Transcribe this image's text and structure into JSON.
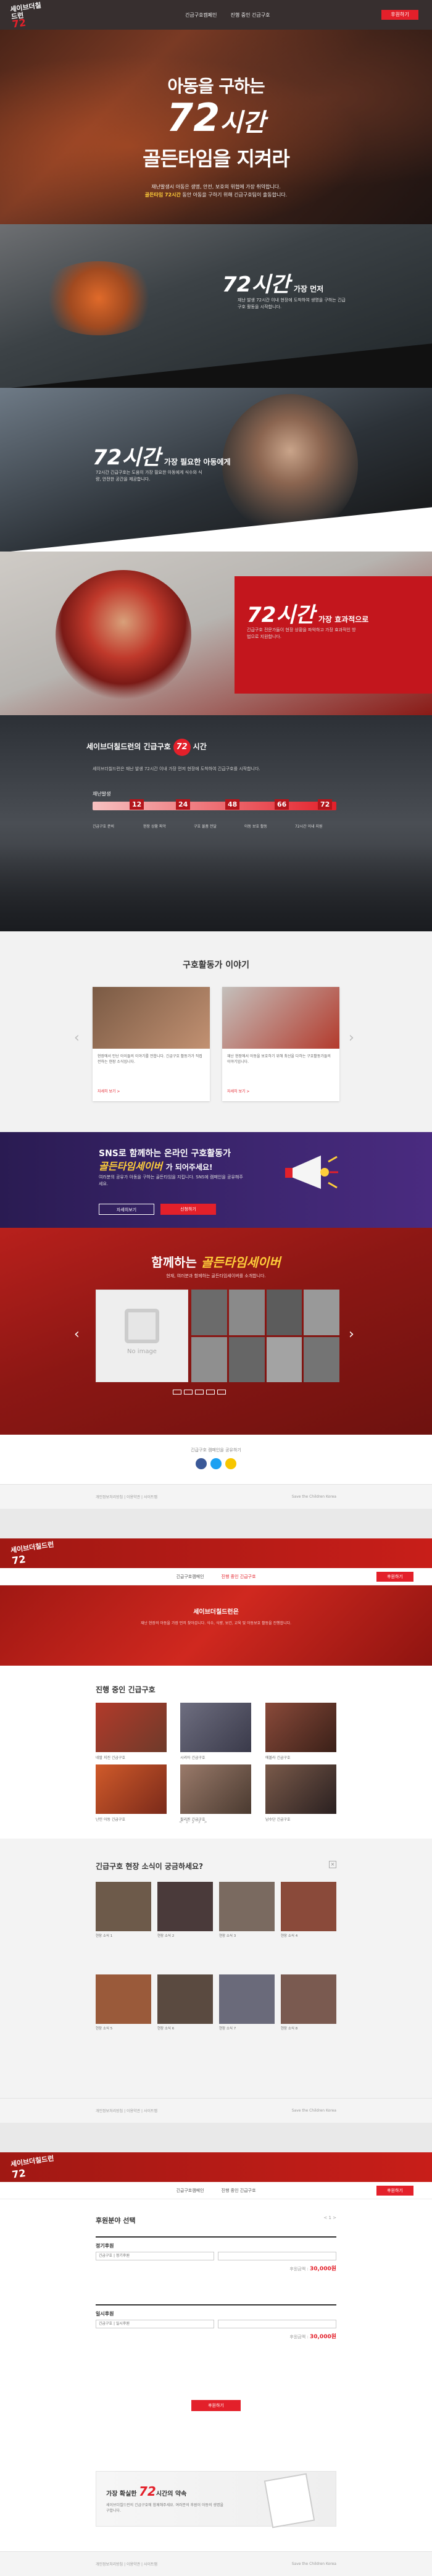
{
  "nav": {
    "logo_top": "세이브더칠드런",
    "logo_big": "72",
    "links": [
      "긴급구호캠페인",
      "진행 중인 긴급구호"
    ],
    "cta": "후원하기"
  },
  "hero": {
    "line1": "아동을 구하는",
    "line2_num": "72",
    "line2_unit": "시간",
    "line3": "골든타임을 지켜라",
    "desc1": "재난발생시 아동은 생명, 안전, 보호의 위협에 가장 취약합니다.",
    "desc2_em": "골든타임 72시간",
    "desc2": "동안 아동을 구하기 위해 긴급구호팀이 출동합니다."
  },
  "section_a": {
    "head_num": "72시간",
    "head_sub": "가장 먼저",
    "desc": "재난 발생 72시간 이내 현장에 도착하여 생명을 구하는 긴급구호 활동을 시작합니다."
  },
  "section_b": {
    "head_num": "72시간",
    "head_sub": "가장 필요한 아동에게",
    "desc": "72시간 긴급구호는 도움이 가장 필요한 아동에게 식수와 식량, 안전한 공간을 제공합니다."
  },
  "section_c": {
    "head_num": "72시간",
    "head_sub": "가장 효과적으로",
    "desc": "긴급구호 전문가들이 현장 상황을 파악하고 가장 효과적인 방법으로 지원합니다."
  },
  "timeline": {
    "title_pre": "세이브더칠드런의 긴급구호",
    "title_num": "72",
    "title_post": "시간",
    "desc": "세이브더칠드런은 재난 발생 72시간 이내 가장 먼저 현장에 도착하여 긴급구호를 시작합니다.",
    "phase_label": "재난발생",
    "markers": [
      "12",
      "24",
      "48",
      "66",
      "72"
    ],
    "cols": [
      "긴급구호 준비",
      "현장 상황 파악",
      "구호 물품 전달",
      "아동 보호 활동",
      "72시간 이내 지원"
    ]
  },
  "stories": {
    "title": "구호활동가 이야기",
    "cards": [
      {
        "text": "현장에서 만난 아이들의 이야기를 전합니다. 긴급구호 활동가가 직접 전하는 현장 소식입니다.",
        "more": "자세히 보기 >"
      },
      {
        "text": "재난 현장에서 아동을 보호하기 위해 최선을 다하는 구호활동가들의 이야기입니다.",
        "more": "자세히 보기 >"
      }
    ]
  },
  "sns": {
    "h1": "SNS로 함께하는 온라인 구호활동가",
    "h2": "골든타임세이버",
    "h2_post": "가 되어주세요!",
    "desc": "여러분의 공유가 아동을 구하는 골든타임을 지킵니다. SNS에 캠페인을 공유해주세요.",
    "btn1": "자세히보기",
    "btn2": "신청하기"
  },
  "savers": {
    "pre": "함께하는",
    "name": "골든타임세이버",
    "desc": "현재, 여러분과 함께하는 골든타임세이버를 소개합니다.",
    "noimage": "No image"
  },
  "share": {
    "label": "긴급구호 캠페인을 공유하기"
  },
  "footer": {
    "items": [
      "개인정보처리방침",
      "이용약관",
      "사이트맵"
    ],
    "copyright": "Save the Children Korea"
  },
  "page2": {
    "menu": [
      "긴급구호캠페인",
      "진행 중인 긴급구호"
    ],
    "cta": "후원하기",
    "banner_title": "세이브더칠드런은",
    "banner_desc": "재난 현장의 아동을 가장 먼저 찾아갑니다. 식수, 식량, 보건, 교육 및 아동보호 활동을 진행합니다.",
    "ongoing_title": "진행 중인 긴급구호",
    "ongoing": [
      "네팔 지진 긴급구호",
      "시리아 긴급구호",
      "에볼라 긴급구호",
      "난민 아동 긴급구호",
      "필리핀 긴급구호",
      "남수단 긴급구호"
    ],
    "pager": [
      "<",
      "1",
      "2",
      "3",
      ">"
    ],
    "news_title": "긴급구호 현장 소식이 궁금하세요?",
    "news_close": "×",
    "news": [
      "현장 소식 1",
      "현장 소식 2",
      "현장 소식 3",
      "현장 소식 4",
      "현장 소식 5",
      "현장 소식 6",
      "현장 소식 7",
      "현장 소식 8"
    ]
  },
  "page3": {
    "title": "후원분야 선택",
    "page": "< 1 >",
    "regular_label": "정기후원",
    "regular_field": "긴급구호 | 정기후원",
    "regular_amount": "30,000원",
    "once_label": "일시후원",
    "once_field": "긴급구호 | 일시후원",
    "once_amount": "30,000원",
    "total_label": "후원금액 :",
    "submit": "후원하기",
    "promo_pre": "가장 확실한",
    "promo_num": "72",
    "promo_post": "시간의 약속",
    "promo_desc": "세이브더칠드런의 긴급구호에 함께해주세요. 여러분의 후원이 아동의 생명을 구합니다."
  },
  "colors": {
    "brand": "#e3202a",
    "accent": "#ffce3a"
  }
}
